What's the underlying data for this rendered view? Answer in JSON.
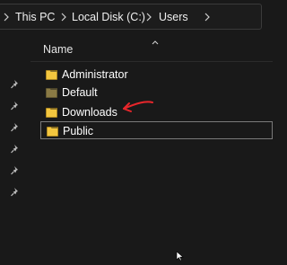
{
  "breadcrumb": {
    "items": [
      "This PC",
      "Local Disk (C:)",
      "Users"
    ]
  },
  "content": {
    "column_header": "Name",
    "folders": [
      {
        "name": "Administrator",
        "icon": "folder-icon"
      },
      {
        "name": "Default",
        "icon": "folder-dim-icon"
      },
      {
        "name": "Downloads",
        "icon": "folder-icon"
      },
      {
        "name": "Public",
        "icon": "folder-icon",
        "selected": true
      }
    ]
  },
  "colors": {
    "background": "#191919",
    "folder_yellow": "#f3c63f",
    "annotation_red": "#e8262b",
    "selection_border": "#7a7a7a"
  },
  "pinned_count": 6
}
